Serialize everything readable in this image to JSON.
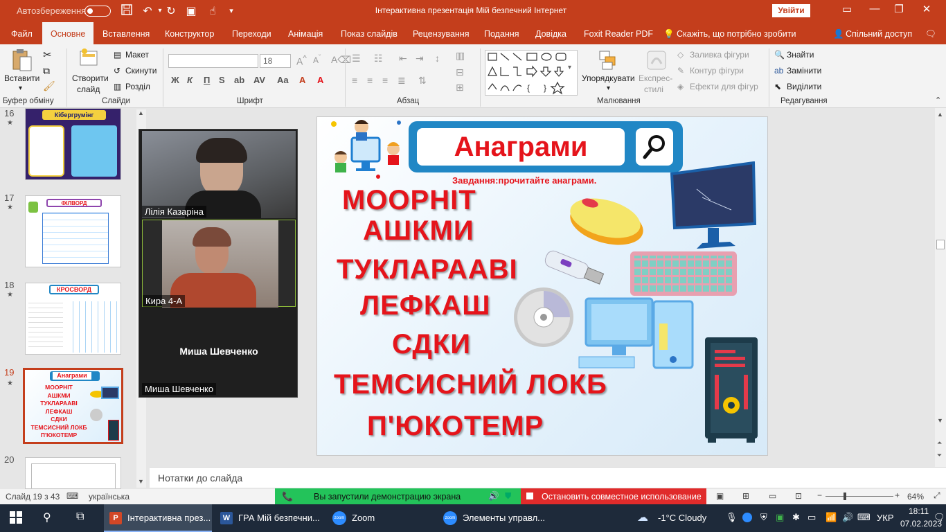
{
  "titlebar": {
    "autosave": "Автозбереження",
    "title": "Інтерактивна презентація Мій безпечний Інтернет",
    "signin": "Увійти"
  },
  "menu": [
    "Файл",
    "Основне",
    "Вставлення",
    "Конструктор",
    "Переходи",
    "Анімація",
    "Показ слайдів",
    "Рецензування",
    "Подання",
    "Довідка",
    "Foxit Reader PDF"
  ],
  "tellme": "Скажіть, що потрібно зробити",
  "share": "Спільний доступ",
  "ribbon": {
    "paste": "Вставити",
    "clipboard": "Буфер обміну",
    "new_slide_1": "Створити",
    "new_slide_2": "слайд",
    "layout": "Макет",
    "reset": "Скинути",
    "section": "Розділ",
    "slides": "Слайди",
    "font_size": "18",
    "font": "Шрифт",
    "bold": "Ж",
    "italic": "К",
    "underline": "П",
    "paragraph": "Абзац",
    "arrange_1": "Упорядкувати",
    "quick_styles_1": "Експрес-",
    "quick_styles_2": "стилі",
    "shape_fill": "Заливка фігури",
    "shape_outline": "Контур фігури",
    "shape_effects": "Ефекти для фігур",
    "drawing": "Малювання",
    "find": "Знайти",
    "replace": "Замінити",
    "select": "Виділити",
    "editing": "Редагування"
  },
  "thumbnails": [
    {
      "num": "16",
      "title": "Кібергрумінг"
    },
    {
      "num": "17",
      "title": "ФІЛВОРД"
    },
    {
      "num": "18",
      "title": "КРОСВОРД"
    },
    {
      "num": "19",
      "title": "Анаграми",
      "words": [
        "МООРНІТ",
        "АШКМИ",
        "ТУКЛАРААВІ",
        "ЛЕФКАШ",
        "СДКИ",
        "ТЕМСИСНИЙ ЛОКБ",
        "П'ЮКОТЕМР"
      ]
    },
    {
      "num": "20",
      "title": ""
    }
  ],
  "zoom": {
    "p1": "Лілія Казаріна",
    "p2": "Кира 4-А",
    "p3_center": "Миша Шевченко",
    "p3": "Миша Шевченко"
  },
  "slide": {
    "title": "Анаграми",
    "task": "Завдання:прочитайте анаграми.",
    "words": [
      "МООРНІТ",
      "АШКМИ",
      "ТУКЛАРААВІ",
      "ЛЕФКАШ",
      "СДКИ",
      "ТЕМСИСНИЙ  ЛОКБ",
      "П'ЮКОТЕМР"
    ]
  },
  "notes": "Нотатки до слайда",
  "status": {
    "slide": "Слайд 19 з 43",
    "lang": "українська",
    "zoom": "64%"
  },
  "zoom_share": {
    "msg": "Вы запустили демонстрацию экрана",
    "stop": "Остановить совместное использование"
  },
  "taskbar": {
    "apps": [
      "Інтерактивна през...",
      "ГРА Мій безпечни...",
      "Zoom",
      "Элементы управл..."
    ],
    "weather": "-1°C  Cloudy",
    "lang": "УКР",
    "time": "18:11",
    "date": "07.02.2023"
  },
  "colors": {
    "accent": "#c43e1c",
    "slide_red": "#e5141b",
    "slide_blue": "#2187c5"
  }
}
